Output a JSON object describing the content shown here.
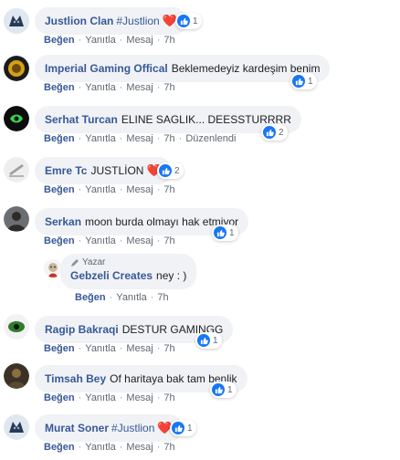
{
  "actions": {
    "like": "Beğen",
    "reply": "Yanıtla",
    "message": "Mesaj",
    "sep": "·",
    "edited": "Düzenlendi"
  },
  "colors": {
    "link": "#385898",
    "bubble": "#f0f2f5",
    "like_blue": "#1877f2",
    "heart": "#e0245e"
  },
  "comments": [
    {
      "author": "Justlion Clan",
      "text": "",
      "hashtag": "#Justlion",
      "heart": "❤️",
      "reactions": "1",
      "time": "7h",
      "avatar_icon": "wolf-icon"
    },
    {
      "author": "Imperial Gaming Offical",
      "text": "Beklemedeyiz kardeşim benim",
      "reactions": "1",
      "time": "7h",
      "avatar_icon": "lion-emblem-icon"
    },
    {
      "author": "Serhat Turcan",
      "text": "ELINE SAGLIK... DEESSTURRRR",
      "reactions": "2",
      "time": "7h",
      "avatar_icon": "green-logo-icon"
    },
    {
      "author": "Emre Tc",
      "text": "JUSTLİON",
      "heart": "❤️",
      "reactions": "2",
      "time": "7h",
      "avatar_icon": "sketch-icon"
    },
    {
      "author": "Serkan",
      "text": "moon burda olmayı hak etmiyor",
      "reactions": "1",
      "time": "7h",
      "avatar_icon": "person-photo-icon"
    },
    {
      "author": "Ragip Bakraqi",
      "text": "DESTUR GAMINGG",
      "reactions": "1",
      "time": "7h",
      "avatar_icon": "green-emblem-icon"
    },
    {
      "author": "Timsah Bey",
      "text": "Of haritaya bak tam benlik",
      "reactions": "1",
      "time": "7h",
      "avatar_icon": "dark-figure-icon"
    },
    {
      "author": "Murat Soner",
      "text": "",
      "hashtag": "#Justlion",
      "heart": "❤️",
      "reactions": "1",
      "time": "7h",
      "avatar_icon": "wolf-icon"
    }
  ],
  "reply": {
    "badge": "Yazar",
    "author": "Gebzeli Creates",
    "text": "ney : )",
    "time": "7h",
    "avatar_icon": "cartoon-avatar-icon"
  }
}
